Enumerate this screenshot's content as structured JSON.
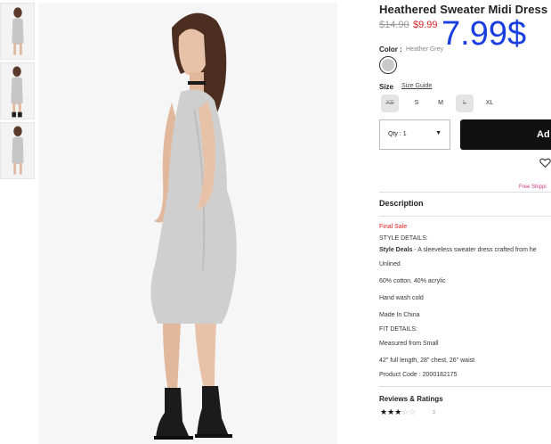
{
  "product": {
    "title": "Heathered Sweater Midi Dress",
    "price_original": "$14.90",
    "price_sale": "$9.99",
    "price_overlay": "7.99$"
  },
  "color": {
    "label": "Color :",
    "value": "Heather Grey",
    "swatch_hex": "#c9c9c9"
  },
  "size": {
    "label": "Size",
    "guide": "Size Guide",
    "options": [
      {
        "label": "XS",
        "available": false
      },
      {
        "label": "S",
        "available": true
      },
      {
        "label": "M",
        "available": true
      },
      {
        "label": "L",
        "available": false
      },
      {
        "label": "XL",
        "available": true
      }
    ]
  },
  "quantity": {
    "value": "Qty : 1",
    "caret": "▼"
  },
  "add_button": {
    "label": "Ad"
  },
  "shipping_note": "Free Shippi",
  "description": {
    "heading": "Description",
    "final_sale": "Final Sale",
    "style_details_label": "STYLE DETAILS:",
    "style_deals_bold": "Style Deals",
    "style_deals_text": " - A sleeveless sweater dress crafted from he",
    "lines": [
      "Unlined",
      "60% cotton, 40% acrylic",
      "Hand wash cold",
      "Made In China"
    ],
    "fit_details_label": "FIT DETAILS:",
    "fit_lines": [
      "Measured from Small",
      "42\" full length, 28\" chest, 26\" waist"
    ],
    "product_code": "Product Code : 2000182175"
  },
  "reviews": {
    "heading": "Reviews & Ratings",
    "rating": 3,
    "max_rating": 5,
    "count": "3"
  },
  "colors": {
    "sale_red": "#dd2222",
    "overlay_blue": "#1a3fe0",
    "button_black": "#111111",
    "shipping_pink": "#d3367c"
  }
}
